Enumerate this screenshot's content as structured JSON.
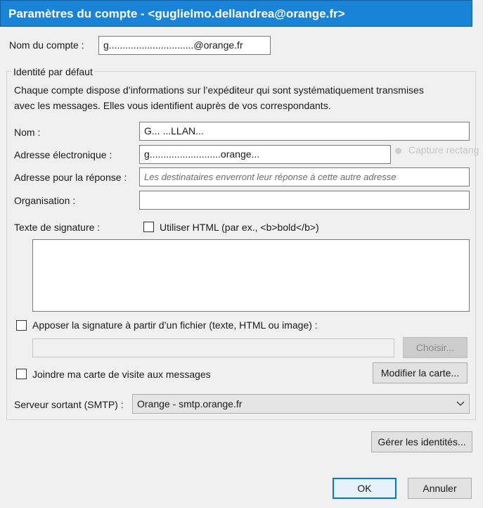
{
  "dialog": {
    "title": "Paramètres du compte - <guglielmo.dellandrea@orange.fr>"
  },
  "account": {
    "label": "Nom du compte :",
    "value": "g...............................@orange.fr"
  },
  "identity": {
    "legend": "Identité par défaut",
    "description_line1": "Chaque compte dispose d’informations sur l’expéditeur qui sont systématiquement transmises",
    "description_line2": "avec les messages. Elles vous identifient auprès de vos correspondants.",
    "name_label": "Nom :",
    "name_value": "G... ...LLAN...",
    "email_label": "Adresse électronique :",
    "email_value": "g..........................orange...",
    "reply_label": "Adresse pour la réponse :",
    "reply_placeholder": "Les destinataires enverront leur réponse à cette autre adresse",
    "org_label": "Organisation :",
    "org_value": "",
    "signature_label": "Texte de signature :",
    "use_html_label": "Utiliser HTML (par ex., <b>bold</b>)",
    "use_html_checked": false,
    "signature_text": "",
    "attach_sig_label": "Apposer la signature à partir d’un fichier (texte, HTML ou image) :",
    "attach_sig_checked": false,
    "file_path": "",
    "choose_button": "Choisir...",
    "vcard_label": "Joindre ma carte de visite aux messages",
    "vcard_checked": false,
    "edit_card_button": "Modifier la carte...",
    "smtp_label": "Serveur sortant (SMTP) :",
    "smtp_value": "Orange - smtp.orange.fr"
  },
  "footer": {
    "manage_identities_button": "Gérer les identités...",
    "ok_button": "OK",
    "cancel_button": "Annuler"
  },
  "background_overlay": {
    "text": "Capture rectang"
  },
  "icons": {
    "smtp_dropdown": "chevron-down-icon"
  },
  "colors": {
    "titlebar": "#1883d7",
    "dialog_bg": "#f0f0f0",
    "ok_border": "#0078d7"
  }
}
